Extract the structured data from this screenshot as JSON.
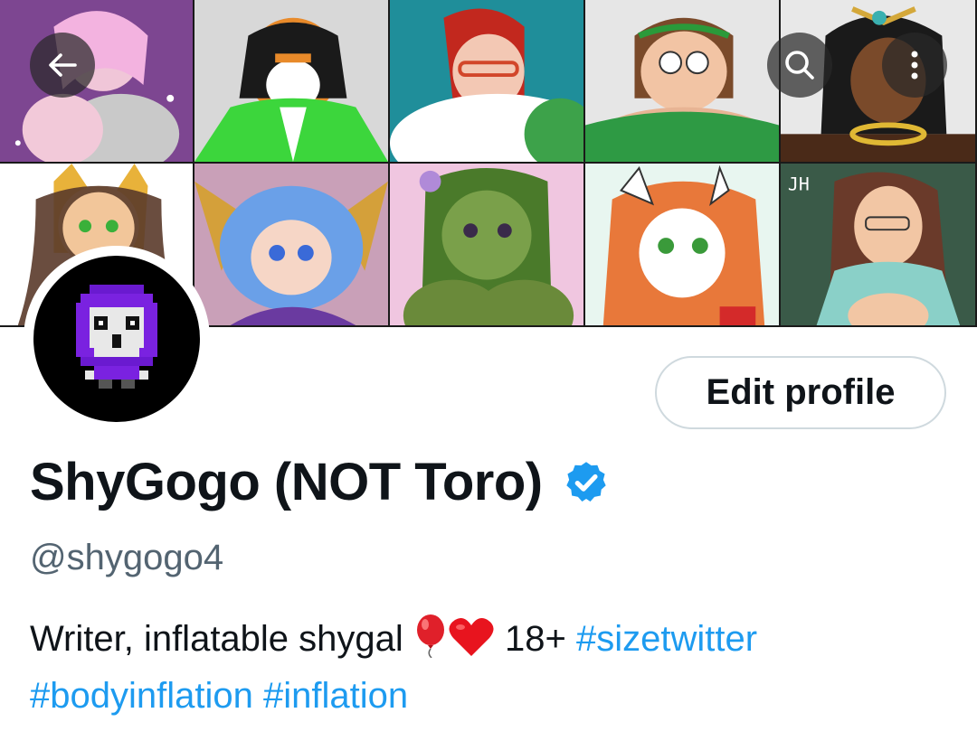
{
  "header": {
    "back_icon": "arrow-left-icon",
    "search_icon": "search-icon",
    "more_icon": "more-vertical-icon"
  },
  "banner": {
    "tiles": [
      "art-1",
      "art-2",
      "art-3",
      "art-4",
      "art-5",
      "art-6",
      "art-7",
      "art-8",
      "art-9",
      "art-10"
    ],
    "chalkboard_text": "JH"
  },
  "profile": {
    "edit_label": "Edit profile",
    "display_name": "ShyGogo (NOT Toro)",
    "verified_icon": "verified-badge-icon",
    "handle": "@shygogo4",
    "bio_text_1": "Writer, inflatable shygal",
    "bio_emoji_1": "balloon-emoji",
    "bio_emoji_2": "heart-emoji",
    "bio_text_2": "18+",
    "hashtags": [
      "#sizetwitter",
      "#bodyinflation",
      "#inflation"
    ]
  },
  "colors": {
    "accent": "#1d9bf0",
    "text": "#0f1419",
    "secondary": "#536471",
    "border": "#cfd9de"
  }
}
